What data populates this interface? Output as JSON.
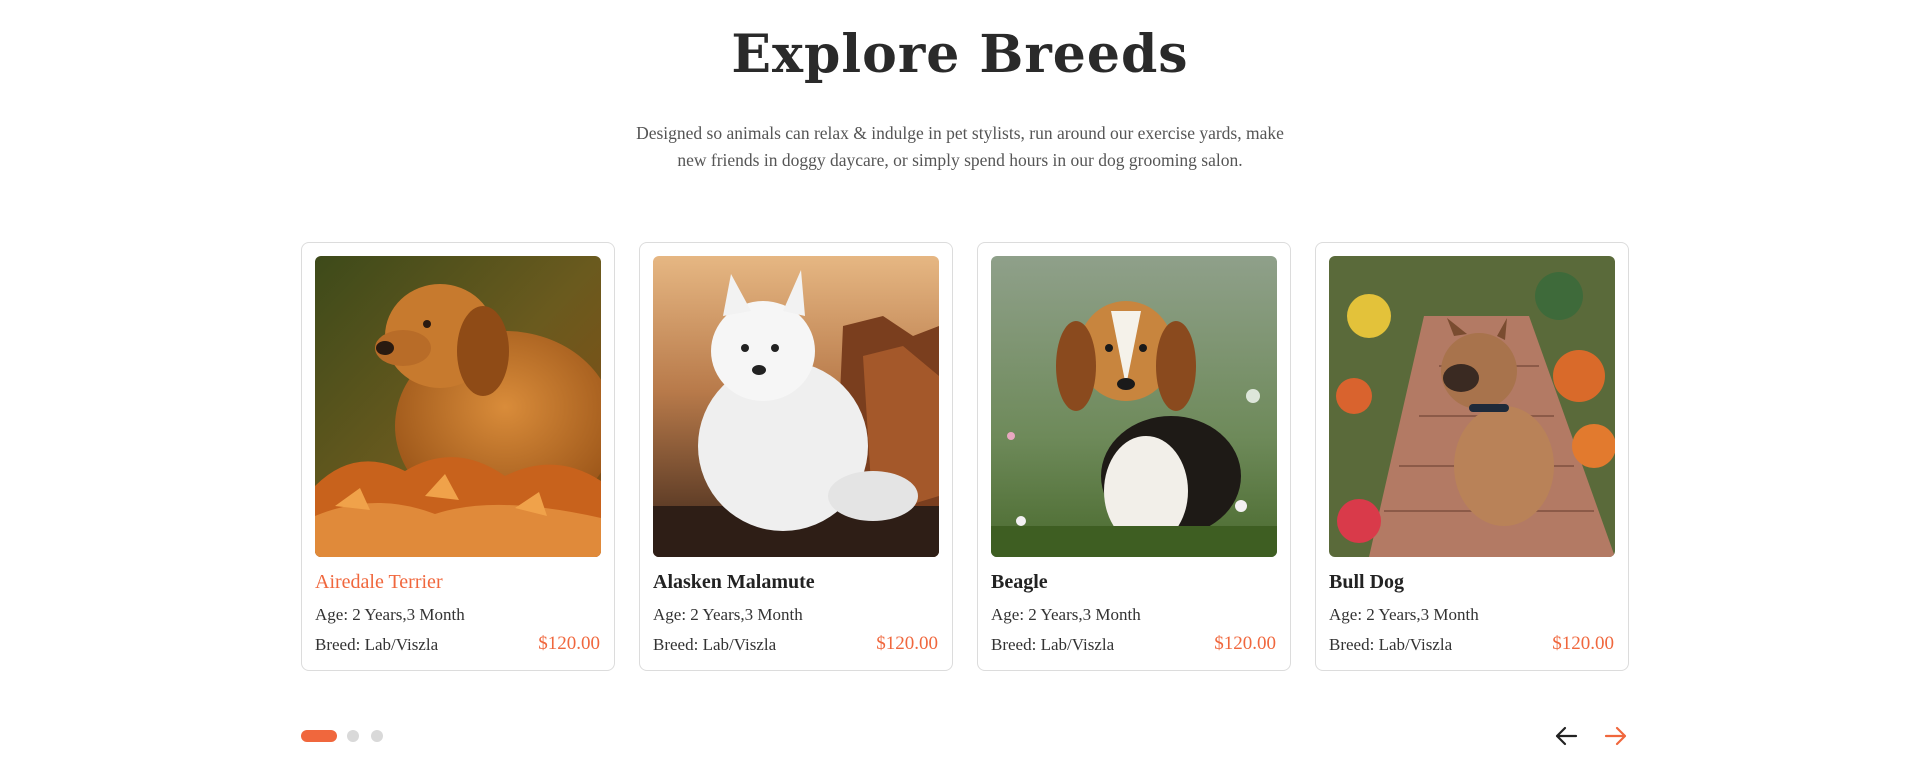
{
  "section": {
    "title": "Explore Breeds",
    "subtitle_line1": "Designed so animals can relax & indulge in pet stylists, run around our exercise yards, make",
    "subtitle_line2": "new friends in doggy daycare, or simply spend hours in our dog grooming salon."
  },
  "cards": [
    {
      "name": "Airedale Terrier",
      "age": "Age: 2 Years,3 Month",
      "breed": "Breed: Lab/Viszla",
      "price": "$120.00",
      "image_icon": "golden-dog-in-autumn-leaves-photo"
    },
    {
      "name": "Alasken Malamute",
      "age": "Age: 2 Years,3 Month",
      "breed": "Breed: Lab/Viszla",
      "price": "$120.00",
      "image_icon": "white-fluffy-dog-photo"
    },
    {
      "name": "Beagle",
      "age": "Age: 2 Years,3 Month",
      "breed": "Breed: Lab/Viszla",
      "price": "$120.00",
      "image_icon": "beagle-in-meadow-photo"
    },
    {
      "name": "Bull Dog",
      "age": "Age: 2 Years,3 Month",
      "breed": "Breed: Lab/Viszla",
      "price": "$120.00",
      "image_icon": "bulldog-on-garden-path-photo"
    }
  ],
  "pagination": {
    "pages": 3,
    "active_page": 1
  },
  "nav": {
    "prev_icon": "arrow-left-icon",
    "next_icon": "arrow-right-icon"
  },
  "colors": {
    "accent": "#f0673d",
    "heading": "#2a2a2a",
    "text": "#333333",
    "border": "#dcdcdc",
    "dot_inactive": "#d9d9d9"
  }
}
